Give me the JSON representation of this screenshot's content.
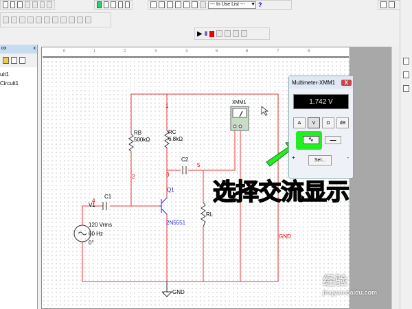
{
  "toolbar": {
    "in_use_list": "--- In Use List ---",
    "help": "?"
  },
  "design_toolbox": {
    "title": "ox",
    "items": [
      "uit1",
      "Circuit1"
    ]
  },
  "ruler": [
    "0",
    "1",
    "2",
    "3",
    "4",
    "5",
    "6",
    "7",
    "8"
  ],
  "circuit": {
    "nodes": [
      "1",
      "2",
      "3",
      "4",
      "5"
    ],
    "rb": {
      "name": "RB",
      "value": "500kΩ"
    },
    "rc": {
      "name": "RC",
      "value": "6.8kΩ"
    },
    "c1": "C1",
    "c2": "C2",
    "rl": "RL",
    "q1": {
      "name": "Q1",
      "model": "2N5551"
    },
    "v1": {
      "name": "V1",
      "amplitude": "120 Vrms",
      "freq": "60 Hz",
      "phase": "0°"
    },
    "meter": "XMM1",
    "gnd": "GND",
    "gnd_net": "GND"
  },
  "multimeter": {
    "title": "Multimeter-XMM1",
    "close": "X",
    "reading": "1.742 V",
    "modes": [
      "A",
      "V",
      "Ω",
      "dB"
    ],
    "selected_mode": "V",
    "ac_symbol": "∿",
    "dc_symbol": "—",
    "set_label": "Set...",
    "plus": "+",
    "minus": "-"
  },
  "annotation": "选择交流显示",
  "watermark": {
    "brand": "经验",
    "url": "jingyan.baidu.com"
  },
  "colors": {
    "wire": "#ee3333",
    "annotation": "#22ee22",
    "transistor": "#2222dd"
  }
}
